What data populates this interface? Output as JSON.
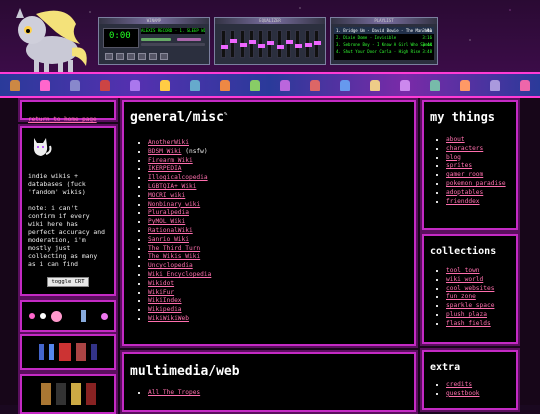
{
  "nav": {
    "home_link": "return to home page"
  },
  "intro": {
    "text": "indie wikis + databases (fuck 'fandom' wikis)",
    "note": "note: i can't confirm if every wiki here has perfect accuracy and moderation, i'm mostly just collecting as many as i can find",
    "crt_button": "toggle CRT"
  },
  "players": {
    "main": {
      "bar": "WINAMP",
      "time": "0:00",
      "track": "ALEXIS RECORD - 1. SLEEP WITHO"
    },
    "eq": {
      "bar": "EQUALIZER",
      "levels": [
        0.55,
        0.3,
        0.45,
        0.35,
        0.5,
        0.4,
        0.55,
        0.35,
        0.5,
        0.45,
        0.4
      ]
    },
    "playlist": {
      "bar": "PLAYLIST",
      "rows": [
        {
          "text": "1. Bridge Um - David Bowie - The Man Who Sol...",
          "time": "3:41",
          "selected": true
        },
        {
          "text": "2. Dixie Dome - Invisible",
          "time": "3:16",
          "selected": false
        },
        {
          "text": "3. Sebrone Boy - I Know A Girl Who Speak Fr...",
          "time": "3:44",
          "selected": false
        },
        {
          "text": "4. Shut Your Door Carla - High Rise",
          "time": "3:48",
          "selected": false
        }
      ]
    }
  },
  "general": {
    "title": "general/misc",
    "items": [
      "AnotherWiki",
      "BDSM Wiki",
      "Firearm Wiki",
      "IKERPEDIA",
      "Illogicalcopedia",
      "LGBTQIA+ Wiki",
      "MOCRI wiki",
      "Nonbinary wiki",
      "Pluralpedia",
      "PyMOL Wiki",
      "RationalWiki",
      "Sanrio Wiki",
      "The Third Turn",
      "The Wikis Wiki",
      "Uncyclopedia",
      "Wiki Encyclopedia",
      "Wikidot",
      "WikiFur",
      "WikiIndex",
      "Wikipedia",
      "WikiWikiWeb"
    ],
    "nsfw_note": "(nsfw)"
  },
  "multimedia": {
    "title": "multimedia/web",
    "items": [
      "All The Tropes"
    ]
  },
  "mythings": {
    "title": "my things",
    "items": [
      "about",
      "characters",
      "blog",
      "sprites",
      "gamer room",
      "pokemon paradise",
      "adoptables",
      "frienddex"
    ]
  },
  "collections": {
    "title": "collections",
    "items": [
      "tool town",
      "wiki world",
      "cool websites",
      "fun zone",
      "sparkle space",
      "plush plaza",
      "flash fields"
    ]
  },
  "extra": {
    "title": "extra",
    "items": [
      "credits",
      "guestbook"
    ]
  },
  "colors": {
    "accent": "#c42ac4",
    "link": "#ff6fae",
    "strip": "#ff3bd5",
    "panel_bg": "#000000",
    "page_bg": "#170619"
  },
  "icons": {
    "mascot": "derpy-pony-sprite",
    "cat": "white-cat-sprite",
    "strip_sprites": [
      "pokemon-sprite",
      "pokemon-sprite",
      "pokemon-sprite",
      "pokemon-sprite",
      "pokemon-sprite",
      "pokemon-sprite",
      "pokemon-sprite",
      "pokemon-sprite",
      "pokemon-sprite",
      "pokemon-sprite",
      "pokemon-sprite",
      "pokemon-sprite",
      "pokemon-sprite",
      "pokemon-sprite",
      "pokemon-sprite",
      "pokemon-sprite",
      "pokemon-sprite",
      "pokemon-sprite"
    ]
  }
}
